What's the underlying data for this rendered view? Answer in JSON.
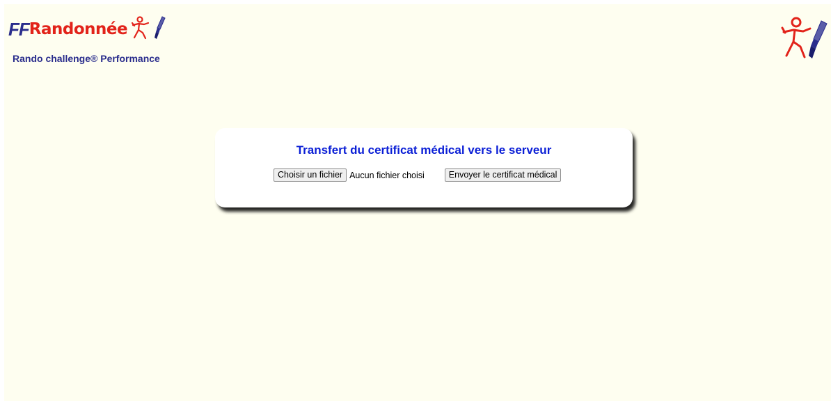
{
  "brand": {
    "ff": "FF",
    "rando": "Randonnée",
    "subtitle": "Rando challenge® Performance",
    "icon": "hiker-icon",
    "secondary_icon": "paintbrush-icon"
  },
  "upload_form": {
    "title": "Transfert du certificat médical vers le serveur",
    "choose_file_label": "Choisir un fichier",
    "file_status": "Aucun fichier choisi",
    "submit_label": "Envoyer le certificat médical"
  },
  "colors": {
    "background": "#fefef0",
    "brand_blue": "#2a2d8c",
    "brand_red": "#e2231a",
    "title_blue": "#0b1fd6"
  }
}
